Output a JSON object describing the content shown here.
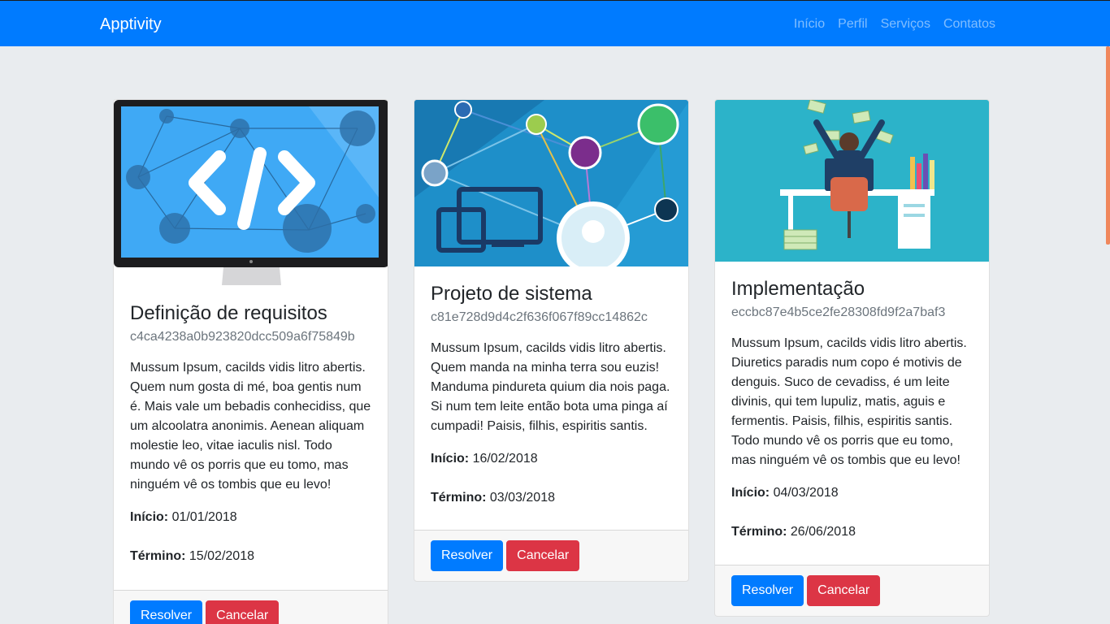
{
  "navbar": {
    "brand": "Apptivity",
    "links": [
      "Início",
      "Perfil",
      "Serviços",
      "Contatos"
    ]
  },
  "cards": [
    {
      "image": "code-monitor-network-illustration",
      "title": "Definição de requisitos",
      "subtitle": "c4ca4238a0b923820dcc509a6f75849b",
      "text": "Mussum Ipsum, cacilds vidis litro abertis. Quem num gosta di mé, boa gentis num é. Mais vale um bebadis conhecidiss, que um alcoolatra anonimis. Aenean aliquam molestie leo, vitae iaculis nisl. Todo mundo vê os porris que eu tomo, mas ninguém vê os tombis que eu levo!",
      "start_label": "Início:",
      "start_date": "01/01/2018",
      "end_label": "Término:",
      "end_date": "15/02/2018",
      "resolve_label": "Resolver",
      "cancel_label": "Cancelar"
    },
    {
      "image": "devices-people-network-illustration",
      "title": "Projeto de sistema",
      "subtitle": "c81e728d9d4c2f636f067f89cc14862c",
      "text": "Mussum Ipsum, cacilds vidis litro abertis. Quem manda na minha terra sou euzis! Manduma pindureta quium dia nois paga. Si num tem leite então bota uma pinga aí cumpadi! Paisis, filhis, espiritis santis.",
      "start_label": "Início:",
      "start_date": "16/02/2018",
      "end_label": "Término:",
      "end_date": "03/03/2018",
      "resolve_label": "Resolver",
      "cancel_label": "Cancelar"
    },
    {
      "image": "developer-desk-money-illustration",
      "title": "Implementação",
      "subtitle": "eccbc87e4b5ce2fe28308fd9f2a7baf3",
      "text": "Mussum Ipsum, cacilds vidis litro abertis. Diuretics paradis num copo é motivis de denguis. Suco de cevadiss, é um leite divinis, qui tem lupuliz, matis, aguis e fermentis. Paisis, filhis, espiritis santis. Todo mundo vê os porris que eu tomo, mas ninguém vê os tombis que eu levo!",
      "start_label": "Início:",
      "start_date": "04/03/2018",
      "end_label": "Término:",
      "end_date": "26/06/2018",
      "resolve_label": "Resolver",
      "cancel_label": "Cancelar"
    }
  ],
  "colors": {
    "primary": "#007bff",
    "danger": "#dc3545",
    "background": "#e9ecef",
    "muted": "#6c757d"
  }
}
